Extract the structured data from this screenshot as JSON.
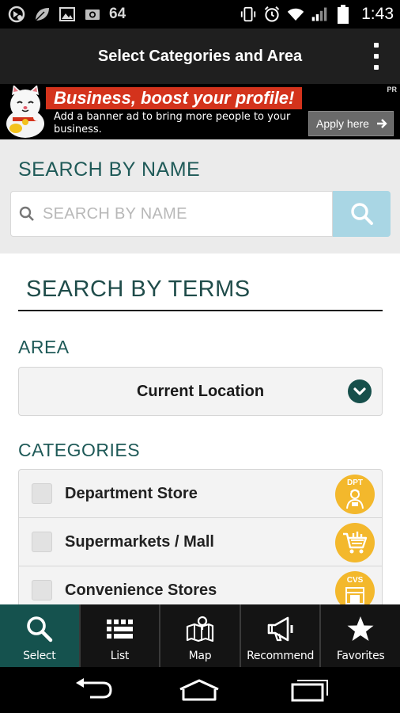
{
  "status_bar": {
    "notification_count": "64",
    "time": "1:43",
    "icons": [
      "app-notification-icon",
      "leaf-icon",
      "image-icon",
      "camera-icon",
      "vibrate-icon",
      "alarm-icon",
      "wifi-icon",
      "signal-icon",
      "battery-icon"
    ]
  },
  "action_bar": {
    "title": "Select Categories and Area",
    "overflow_icon": "overflow-menu-icon"
  },
  "banner": {
    "headline": "Business, boost your profile!",
    "subtext": "Add a banner ad to bring more people to your business.",
    "cta": "Apply here",
    "pr_label": "PR",
    "headline_color": "#d4331c"
  },
  "search_by_name": {
    "heading": "SEARCH BY NAME",
    "placeholder": "SEARCH BY NAME",
    "button_color": "#a9d6e4"
  },
  "search_by_terms": {
    "heading": "SEARCH BY TERMS",
    "area_label": "AREA",
    "area_value": "Current Location",
    "categories_label": "CATEGORIES",
    "categories": [
      {
        "label": "Department Store",
        "badge": "DPT",
        "icon": "department-store-icon"
      },
      {
        "label": "Supermarkets / Mall",
        "badge": "",
        "icon": "shopping-cart-icon"
      },
      {
        "label": "Convenience Stores",
        "badge": "CVS",
        "icon": "convenience-store-icon"
      }
    ],
    "accent_color": "#1f5a58",
    "badge_color": "#f3b82c"
  },
  "tabs": [
    {
      "label": "Select",
      "icon": "search-icon",
      "active": true
    },
    {
      "label": "List",
      "icon": "list-icon",
      "active": false
    },
    {
      "label": "Map",
      "icon": "map-icon",
      "active": false
    },
    {
      "label": "Recommend",
      "icon": "megaphone-icon",
      "active": false
    },
    {
      "label": "Favorites",
      "icon": "star-icon",
      "active": false
    }
  ],
  "tab_active_color": "#15524e",
  "nav_bar": {
    "buttons": [
      "back-icon",
      "home-icon",
      "recent-apps-icon"
    ]
  }
}
